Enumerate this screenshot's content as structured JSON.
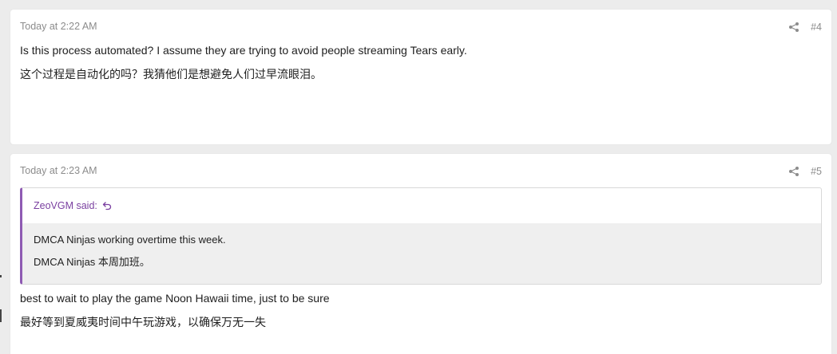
{
  "posts": [
    {
      "time": "Today at 2:22 AM",
      "number": "#4",
      "lines": [
        "Is this process automated? I assume they are trying to avoid people streaming Tears early.",
        "这个过程是自动化的吗？我猜他们是想避免人们过早流眼泪。"
      ]
    },
    {
      "time": "Today at 2:23 AM",
      "number": "#5",
      "quote": {
        "author_label": "ZeoVGM said:",
        "lines": [
          "DMCA Ninjas working overtime this week.",
          "DMCA Ninjas 本周加班。"
        ]
      },
      "lines": [
        "best to wait to play the game Noon Hawaii time, just to be sure",
        "最好等到夏威夷时间中午玩游戏，以确保万无一失"
      ]
    }
  ],
  "icons": {
    "share": "share-icon",
    "jump": "jump-to-quote-icon"
  },
  "colors": {
    "background": "#ececec",
    "card": "#ffffff",
    "muted_text": "#8c8c8c",
    "quote_accent": "#8f5bb3",
    "quote_author": "#7a3fa0",
    "quote_body_bg": "#efefef"
  }
}
